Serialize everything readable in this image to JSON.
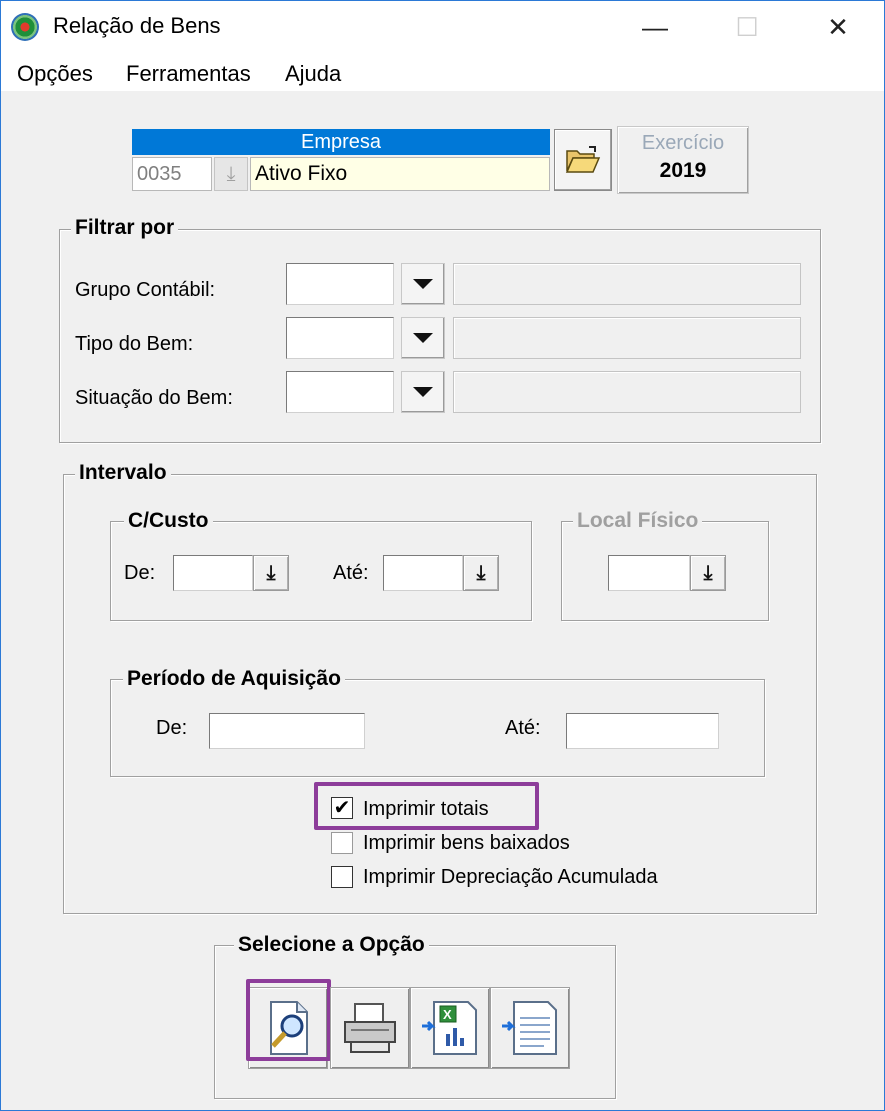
{
  "window": {
    "title": "Relação de Bens",
    "controls": {
      "minimize": "—",
      "maximize": "☐",
      "close": "✕"
    }
  },
  "menu": [
    "Opções",
    "Ferramentas",
    "Ajuda"
  ],
  "empresa": {
    "header": "Empresa",
    "code": "0035",
    "name": "Ativo Fixo",
    "exercicio_label": "Exercício",
    "exercicio_value": "2019"
  },
  "filtrar": {
    "title": "Filtrar por",
    "rows": [
      {
        "label": "Grupo Contábil:"
      },
      {
        "label": "Tipo do Bem:"
      },
      {
        "label": "Situação do Bem:"
      }
    ]
  },
  "intervalo": {
    "title": "Intervalo",
    "ccusto": {
      "title": "C/Custo",
      "de_label": "De:",
      "ate_label": "Até:"
    },
    "local_fisico": {
      "title": "Local Físico"
    },
    "periodo": {
      "title": "Período de Aquisição",
      "de_label": "De:",
      "ate_label": "Até:"
    },
    "checks": [
      {
        "label": "Imprimir totais",
        "checked": true
      },
      {
        "label": "Imprimir bens baixados",
        "checked": false
      },
      {
        "label": "Imprimir Depreciação Acumulada",
        "checked": false
      }
    ]
  },
  "opcao": {
    "title": "Selecione a Opção",
    "buttons": [
      "preview-icon",
      "printer-icon",
      "excel-export-icon",
      "text-export-icon"
    ]
  },
  "colors": {
    "accent": "#0078d7",
    "highlight": "#8d3d9a",
    "empresa_bg": "#ffffe6"
  }
}
